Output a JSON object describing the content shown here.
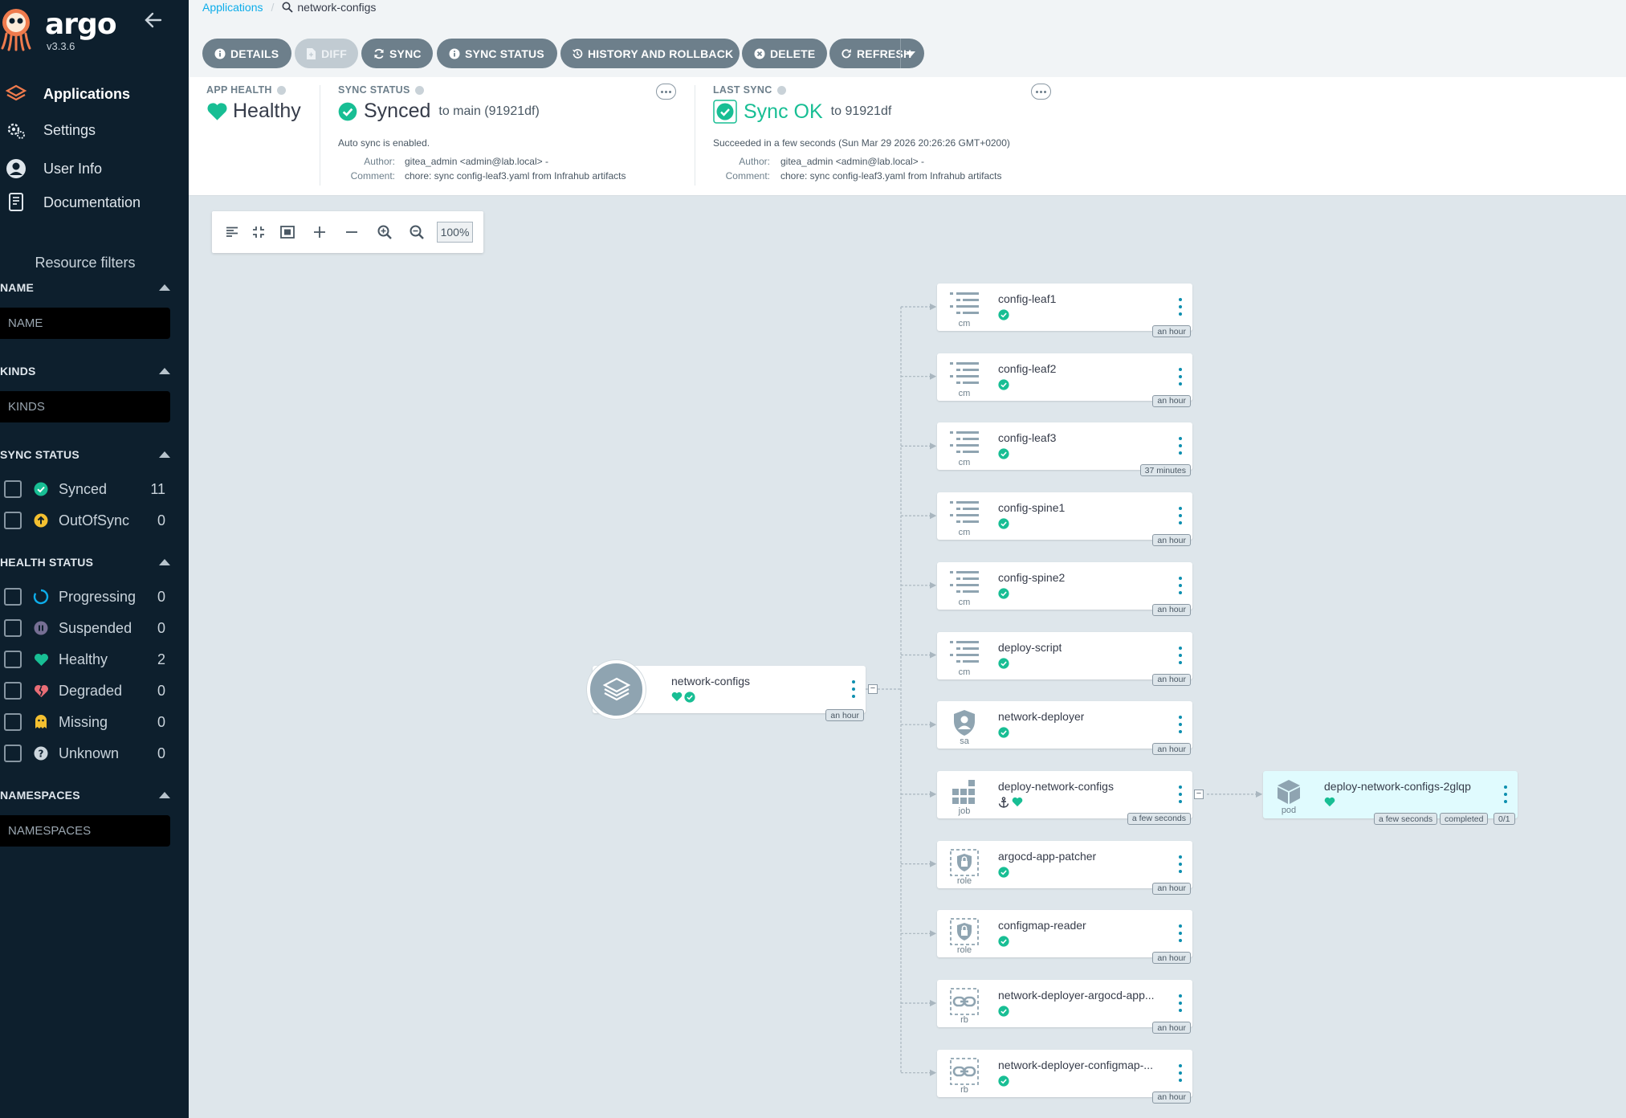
{
  "app": {
    "logo_text": "argo",
    "version": "v3.3.6"
  },
  "sidebar": {
    "nav": [
      {
        "label": "Applications",
        "icon": "layers-icon"
      },
      {
        "label": "Settings",
        "icon": "gears-icon"
      },
      {
        "label": "User Info",
        "icon": "user-icon"
      },
      {
        "label": "Documentation",
        "icon": "book-icon"
      }
    ],
    "filters_title": "Resource filters",
    "name_section": {
      "title": "NAME",
      "placeholder": "NAME"
    },
    "kinds_section": {
      "title": "KINDS",
      "placeholder": "KINDS"
    },
    "sync_status": {
      "title": "SYNC STATUS",
      "items": [
        {
          "label": "Synced",
          "count": "11",
          "icon": "check-circle-icon",
          "color": "#18be94"
        },
        {
          "label": "OutOfSync",
          "count": "0",
          "icon": "arrow-up-circle-icon",
          "color": "#f4c030"
        }
      ]
    },
    "health_status": {
      "title": "HEALTH STATUS",
      "items": [
        {
          "label": "Progressing",
          "count": "0",
          "icon": "circle-notch-icon",
          "color": "#0dadea"
        },
        {
          "label": "Suspended",
          "count": "0",
          "icon": "pause-circle-icon",
          "color": "#766f94"
        },
        {
          "label": "Healthy",
          "count": "2",
          "icon": "heart-icon",
          "color": "#18be94"
        },
        {
          "label": "Degraded",
          "count": "0",
          "icon": "heart-broken-icon",
          "color": "#e96d76"
        },
        {
          "label": "Missing",
          "count": "0",
          "icon": "ghost-icon",
          "color": "#f4c030"
        },
        {
          "label": "Unknown",
          "count": "0",
          "icon": "question-circle-icon",
          "color": "#ccd6dd"
        }
      ]
    },
    "namespaces_section": {
      "title": "NAMESPACES",
      "placeholder": "NAMESPACES"
    }
  },
  "breadcrumb": {
    "root": "Applications",
    "current": "network-configs"
  },
  "toolbar": {
    "buttons": [
      {
        "label": "DETAILS",
        "icon": "info-circle-icon",
        "disabled": false
      },
      {
        "label": "DIFF",
        "icon": "file-icon",
        "disabled": true
      },
      {
        "label": "SYNC",
        "icon": "sync-icon",
        "disabled": false
      },
      {
        "label": "SYNC STATUS",
        "icon": "info-circle-icon",
        "disabled": false
      },
      {
        "label": "HISTORY AND ROLLBACK",
        "icon": "history-icon",
        "disabled": false
      },
      {
        "label": "DELETE",
        "icon": "times-circle-icon",
        "disabled": false
      },
      {
        "label": "REFRESH",
        "icon": "redo-icon",
        "disabled": false
      }
    ]
  },
  "summary": {
    "app_health": {
      "label": "APP HEALTH",
      "value": "Healthy"
    },
    "sync_status": {
      "label": "SYNC STATUS",
      "value": "Synced",
      "target": "to main (91921df)",
      "auto_sync": "Auto sync is enabled.",
      "author_key": "Author:",
      "author": "gitea_admin <admin@lab.local> -",
      "comment_key": "Comment:",
      "comment": "chore: sync config-leaf3.yaml from Infrahub artifacts"
    },
    "last_sync": {
      "label": "LAST SYNC",
      "value": "Sync OK",
      "target": "to 91921df",
      "result": "Succeeded in a few seconds (Sun Mar 29 2026 20:26:26 GMT+0200)",
      "author_key": "Author:",
      "author": "gitea_admin <admin@lab.local> -",
      "comment_key": "Comment:",
      "comment": "chore: sync config-leaf3.yaml from Infrahub artifacts"
    }
  },
  "graph": {
    "zoom": "100%",
    "app_node": {
      "name": "network-configs",
      "age": "an hour"
    },
    "resources": [
      {
        "name": "config-leaf1",
        "kind": "cm",
        "age": "an hour"
      },
      {
        "name": "config-leaf2",
        "kind": "cm",
        "age": "an hour"
      },
      {
        "name": "config-leaf3",
        "kind": "cm",
        "age": "37 minutes"
      },
      {
        "name": "config-spine1",
        "kind": "cm",
        "age": "an hour"
      },
      {
        "name": "config-spine2",
        "kind": "cm",
        "age": "an hour"
      },
      {
        "name": "deploy-script",
        "kind": "cm",
        "age": "an hour"
      },
      {
        "name": "network-deployer",
        "kind": "sa",
        "age": "an hour"
      },
      {
        "name": "deploy-network-configs",
        "kind": "job",
        "age": "a few seconds"
      },
      {
        "name": "argocd-app-patcher",
        "kind": "role",
        "age": "an hour"
      },
      {
        "name": "configmap-reader",
        "kind": "role",
        "age": "an hour"
      },
      {
        "name": "network-deployer-argocd-app...",
        "kind": "rb",
        "age": "an hour"
      },
      {
        "name": "network-deployer-configmap-...",
        "kind": "rb",
        "age": "an hour"
      }
    ],
    "pod_node": {
      "name": "deploy-network-configs-2glqp",
      "kind": "pod",
      "tags": [
        "a few seconds",
        "completed",
        "0/1"
      ]
    }
  }
}
